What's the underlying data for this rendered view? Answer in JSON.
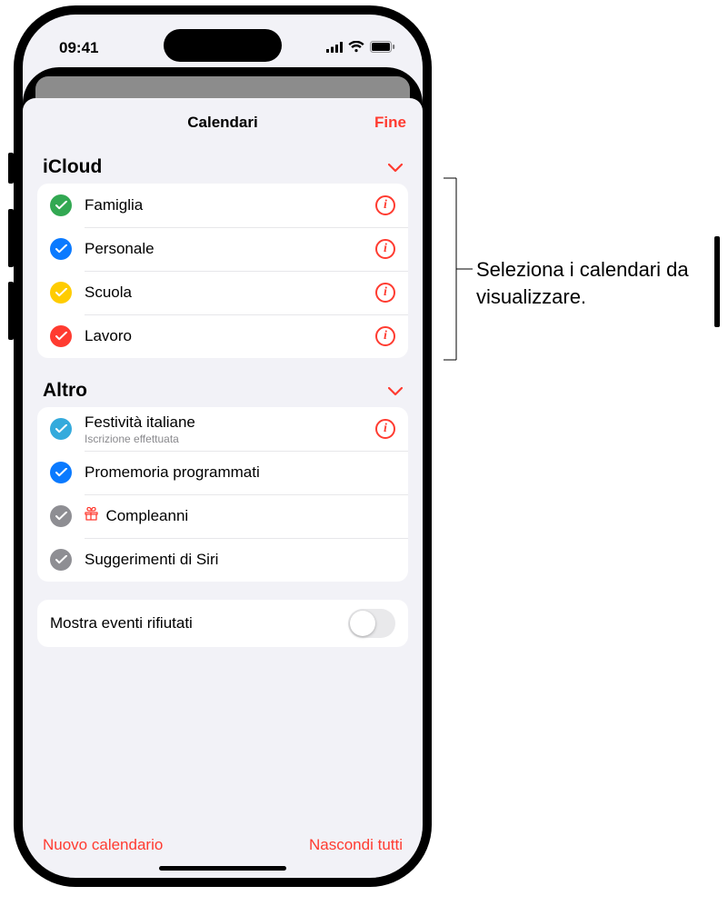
{
  "status": {
    "time": "09:41"
  },
  "header": {
    "title": "Calendari",
    "done": "Fine"
  },
  "sections": {
    "icloud": {
      "title": "iCloud",
      "items": [
        {
          "label": "Famiglia",
          "color": "#32a852"
        },
        {
          "label": "Personale",
          "color": "#0a7aff"
        },
        {
          "label": "Scuola",
          "color": "#ffcc00"
        },
        {
          "label": "Lavoro",
          "color": "#ff3b30"
        }
      ]
    },
    "other": {
      "title": "Altro",
      "items": [
        {
          "label": "Festività italiane",
          "sub": "Iscrizione effettuata",
          "color": "#34aadc",
          "info": true
        },
        {
          "label": "Promemoria programmati",
          "color": "#0a7aff",
          "info": false
        },
        {
          "label": "Compleanni",
          "color": "#8e8e93",
          "info": false,
          "gift": true
        },
        {
          "label": "Suggerimenti di Siri",
          "color": "#8e8e93",
          "info": false
        }
      ]
    }
  },
  "toggle": {
    "label": "Mostra eventi rifiutati"
  },
  "footer": {
    "new": "Nuovo calendario",
    "hide": "Nascondi tutti"
  },
  "callout": {
    "text": "Seleziona i calendari da visualizzare."
  }
}
